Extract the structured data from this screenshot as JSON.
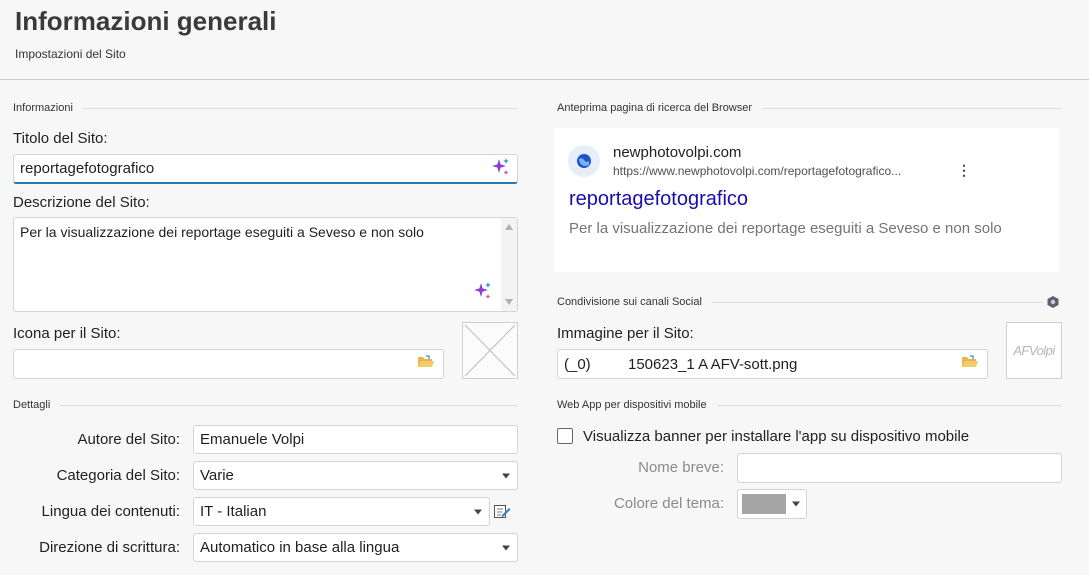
{
  "header": {
    "title": "Informazioni generali",
    "subtitle": "Impostazioni del Sito"
  },
  "info": {
    "section": "Informazioni",
    "site_title_label": "Titolo del Sito:",
    "site_title_value": "reportagefotografico",
    "desc_label": "Descrizione del Sito:",
    "desc_value": "Per la visualizzazione dei reportage eseguiti a Seveso e non solo",
    "icon_label": "Icona per il Sito:",
    "icon_value": ""
  },
  "details": {
    "section": "Dettagli",
    "author_label": "Autore del Sito:",
    "author_value": "Emanuele Volpi",
    "category_label": "Categoria del Sito:",
    "category_value": "Varie",
    "language_label": "Lingua dei contenuti:",
    "language_value": "IT - Italian",
    "direction_label": "Direzione di scrittura:",
    "direction_value": "Automatico in base alla lingua"
  },
  "preview": {
    "section": "Anteprima pagina di ricerca del Browser",
    "site_name": "newphotovolpi.com",
    "url": "https://www.newphotovolpi.com/reportagefotografico...",
    "title": "reportagefotografico",
    "description": "Per la visualizzazione dei reportage eseguiti a Seveso e non solo",
    "link_color": "#1a0dab"
  },
  "social": {
    "section": "Condivisione sui canali Social",
    "image_label": "Immagine per il Sito:",
    "image_prefix": "(_0)",
    "image_value": "150623_1 A AFV-sott.png",
    "thumb_text": "AFVolpi"
  },
  "webapp": {
    "section": "Web App per dispositivi mobile",
    "banner_label": "Visualizza banner per installare l'app su dispositivo mobile",
    "banner_checked": false,
    "short_name_label": "Nome breve:",
    "short_name_value": "",
    "theme_color_label": "Colore del tema:",
    "theme_color": "#a6a6a6"
  }
}
